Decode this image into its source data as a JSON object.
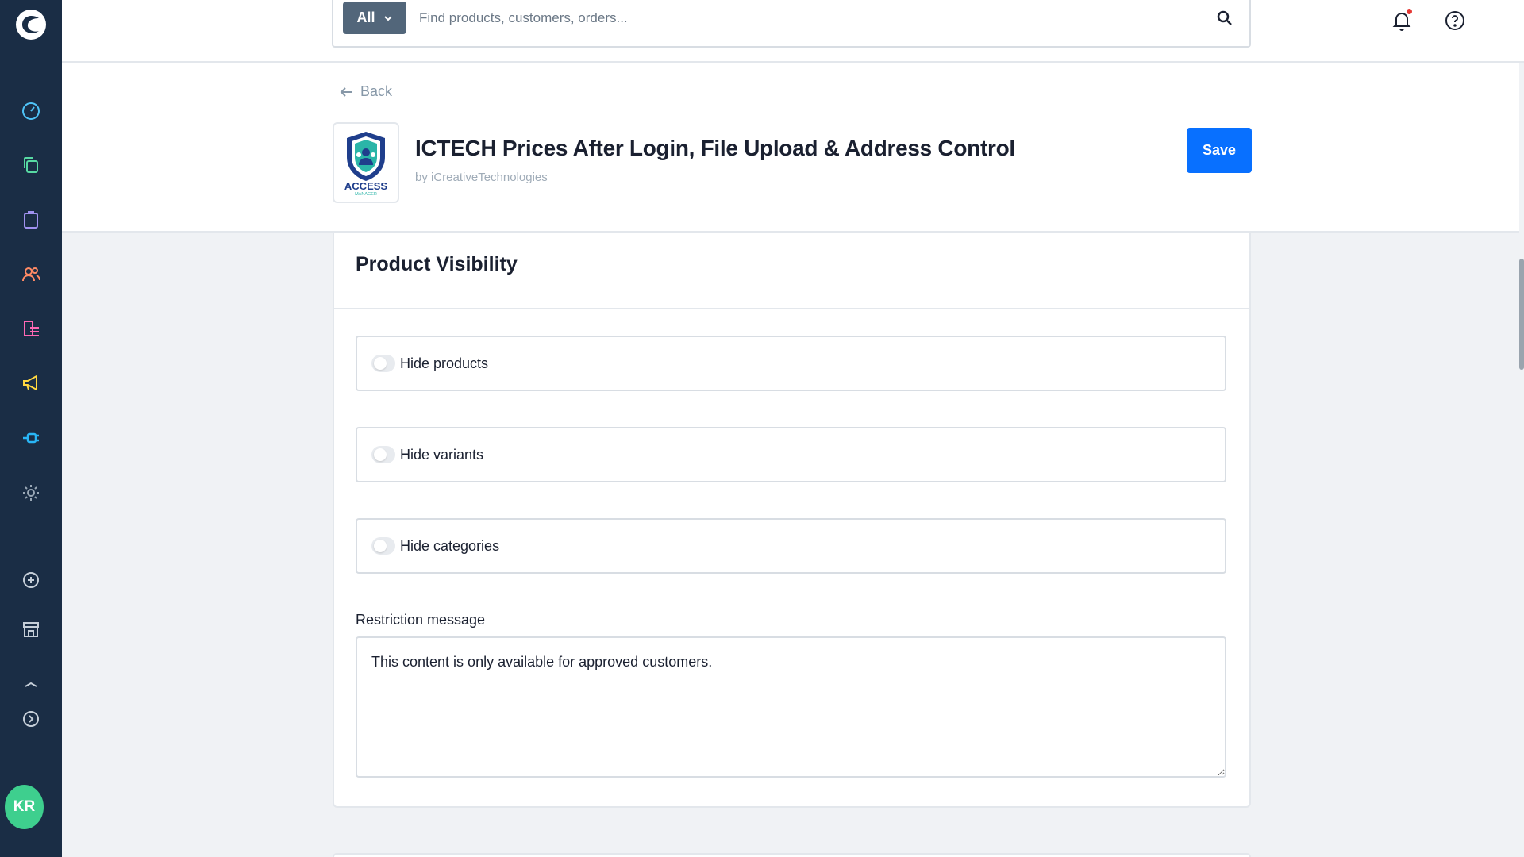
{
  "sidebar": {
    "logo": "shopware-logo",
    "items": [
      {
        "icon": "dashboard-gauge-icon",
        "color": "#4fc3f7"
      },
      {
        "icon": "catalog-copy-icon",
        "color": "#57d9a3"
      },
      {
        "icon": "orders-clipboard-icon",
        "color": "#a092f0"
      },
      {
        "icon": "customers-users-icon",
        "color": "#ff8a65"
      },
      {
        "icon": "content-list-icon",
        "color": "#ff68b4"
      },
      {
        "icon": "marketing-megaphone-icon",
        "color": "#ffd740"
      },
      {
        "icon": "extensions-plug-icon",
        "color": "#29b6f6"
      },
      {
        "icon": "settings-gear-icon",
        "color": "#9aa8b6"
      },
      {
        "icon": "add-circle-icon",
        "color": "#c5ced8"
      },
      {
        "icon": "storefront-shop-icon",
        "color": "#c5ced8"
      },
      {
        "icon": "collapse-up-icon",
        "color": "#c5ced8"
      },
      {
        "icon": "expand-arrow-icon",
        "color": "#c5ced8"
      }
    ],
    "avatar_initials": "KR"
  },
  "search": {
    "filter_label": "All",
    "placeholder": "Find products, customers, orders..."
  },
  "header": {
    "back_label": "Back",
    "app_title": "ICTECH Prices After Login, File Upload & Address Control",
    "app_author": "by iCreativeTechnologies",
    "save_label": "Save",
    "logo_text": "ACCESS",
    "logo_subtext": "MANAGER"
  },
  "card": {
    "title": "Product Visibility",
    "toggles": [
      {
        "label": "Hide products",
        "enabled": false
      },
      {
        "label": "Hide variants",
        "enabled": false
      },
      {
        "label": "Hide categories",
        "enabled": false
      }
    ],
    "restriction_label": "Restriction message",
    "restriction_value": "This content is only available for approved customers."
  },
  "colors": {
    "sidebar_bg": "#1a2d45",
    "primary": "#0870ff",
    "avatar": "#3ecf8e",
    "notification": "#e53935"
  }
}
